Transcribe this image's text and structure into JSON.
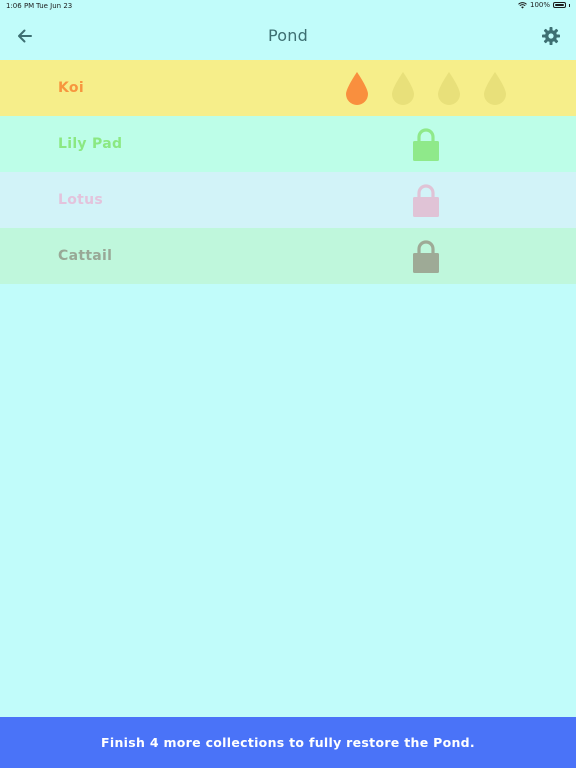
{
  "status_bar": {
    "time": "1:06 PM",
    "date": "Tue Jun 23",
    "battery": "100%"
  },
  "header": {
    "title": "Pond",
    "back_icon": "arrow-left-icon",
    "settings_icon": "gear-icon"
  },
  "collections": [
    {
      "name": "Koi",
      "bg": "#f6ee8a",
      "color": "#f7963e",
      "status": "unlocked",
      "drops_filled": 1,
      "drops_total": 4,
      "drop_filled_color": "#f98f3e",
      "drop_empty_color": "#e8e07a"
    },
    {
      "name": "Lily Pad",
      "bg": "#bdfee8",
      "color": "#8be882",
      "status": "locked",
      "lock_color": "#8fe98a"
    },
    {
      "name": "Lotus",
      "bg": "#d2f3f8",
      "color": "#e3c3dc",
      "status": "locked",
      "lock_color": "#e0c3d6"
    },
    {
      "name": "Cattail",
      "bg": "#bff7dc",
      "color": "#98a896",
      "status": "locked",
      "lock_color": "#9eaa96"
    }
  ],
  "footer": {
    "message": "Finish 4 more collections to fully restore the Pond.",
    "bg": "#4a73f8"
  }
}
